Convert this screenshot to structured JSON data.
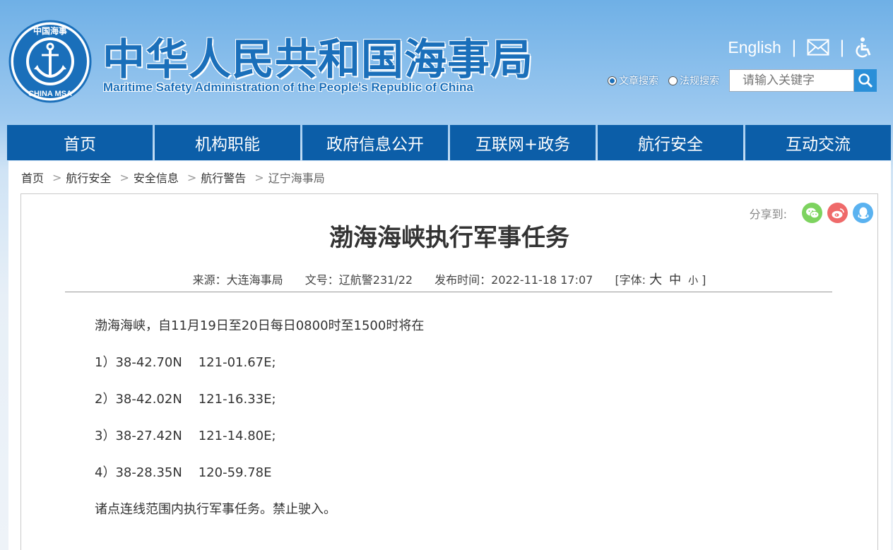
{
  "header": {
    "title_cn": "中华人民共和国海事局",
    "title_en": "Maritime Safety Administration of the People's Republic of China",
    "logo_text_top": "中国海事",
    "logo_text_bottom": "CHINA MSA",
    "english_link": "English",
    "separator": "|",
    "search": {
      "option_article": "文章搜索",
      "option_law": "法规搜索",
      "selected": "文章搜索",
      "placeholder": "请输入关键字"
    }
  },
  "nav": {
    "items": [
      "首页",
      "机构职能",
      "政府信息公开",
      "互联网+政务",
      "航行安全",
      "互动交流"
    ]
  },
  "breadcrumb": {
    "items": [
      "首页",
      "航行安全",
      "安全信息",
      "航行警告",
      "辽宁海事局"
    ],
    "separator": ">"
  },
  "article": {
    "share_label": "分享到:",
    "title": "渤海海峡执行军事任务",
    "meta": {
      "source": "来源：大连海事局",
      "doc_no": "文号：辽航警231/22",
      "published": "发布时间：2022-11-18 17:07",
      "font_label": "[字体:",
      "font_large": "大",
      "font_medium": "中",
      "font_small": "小",
      "font_close": "]"
    },
    "paragraphs": [
      "渤海海峡，自11月19日至20日每日0800时至1500时将在",
      "1）38-42.70N    121-01.67E;",
      "2）38-42.02N    121-16.33E;",
      "3）38-27.42N    121-14.80E;",
      "4）38-28.35N    120-59.78E",
      "诸点连线范围内执行军事任务。禁止驶入。"
    ]
  },
  "colors": {
    "brand_blue": "#1a6fba",
    "nav_blue": "#0c5ea8",
    "wechat_green": "#7dd35f",
    "weibo_red": "#ef6a6a",
    "qq_blue": "#5ab2f0"
  }
}
